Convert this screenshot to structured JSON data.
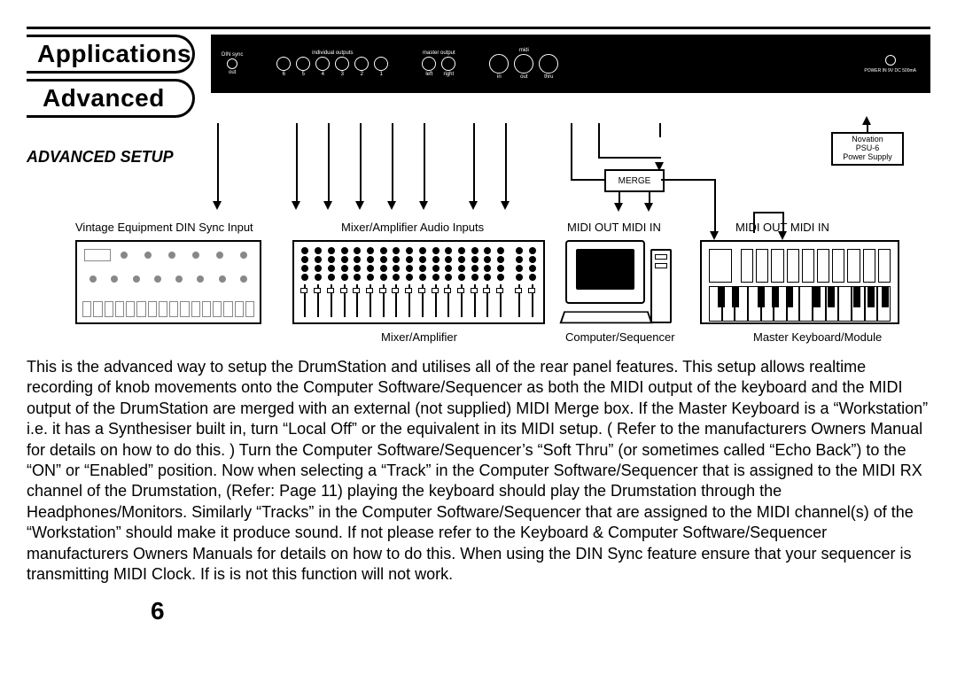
{
  "tabs": {
    "top": "Applications",
    "bottom": "Advanced"
  },
  "panel": {
    "din_sync": "DIN sync",
    "din_out": "out",
    "individual": "individual outputs",
    "ind_nums": [
      "6",
      "5",
      "4",
      "3",
      "2",
      "1"
    ],
    "master": "master output",
    "master_l": "left",
    "master_r": "right",
    "midi": "midi",
    "midi_in": "in",
    "midi_out": "out",
    "midi_thru": "thru",
    "power": "POWER IN 9V DC 500mA"
  },
  "diagram": {
    "title": "ADVANCED SETUP",
    "merge": "MERGE",
    "psu_l1": "Novation",
    "psu_l2": "PSU-6",
    "psu_l3": "Power Supply",
    "cap_vintage": "Vintage Equipment DIN Sync Input",
    "cap_mixer_inputs": "Mixer/Amplifier Audio Inputs",
    "cap_midi_out_in_1": "MIDI OUT MIDI IN",
    "cap_midi_out_in_2": "MIDI OUT MIDI IN",
    "cap_mixer": "Mixer/Amplifier",
    "cap_computer": "Computer/Sequencer",
    "cap_keyboard": "Master Keyboard/Module"
  },
  "body": "This is the advanced way to setup the DrumStation and utilises all of the rear panel features. This setup allows realtime recording of knob movements onto the Computer Software/Sequencer as both the MIDI output of the keyboard and the MIDI output of the DrumStation are merged with an external (not supplied) MIDI Merge box. If the Master Keyboard is a “Workstation” i.e. it has a Synthesiser built in,  turn “Local Off” or the equivalent in its MIDI setup. ( Refer to the manufacturers Owners Manual for details on how to do this. ) Turn the Computer Software/Sequencer’s “Soft Thru” (or sometimes called “Echo Back”) to the “ON” or “Enabled” position. Now when selecting a “Track” in the Computer Software/Sequencer that is assigned to the MIDI RX channel of the Drumstation, (Refer: Page 11) playing the keyboard should play the Drumstation through the Headphones/Monitors. Similarly “Tracks” in the Computer Software/Sequencer that are assigned to the MIDI channel(s) of the “Workstation” should make it produce sound. If not please refer to the Keyboard & Computer Software/Sequencer manufacturers Owners Manuals for details on how to do this. When using the DIN Sync feature ensure that your sequencer is transmitting MIDI Clock. If is is not this function will not work.",
  "page_num": "6"
}
